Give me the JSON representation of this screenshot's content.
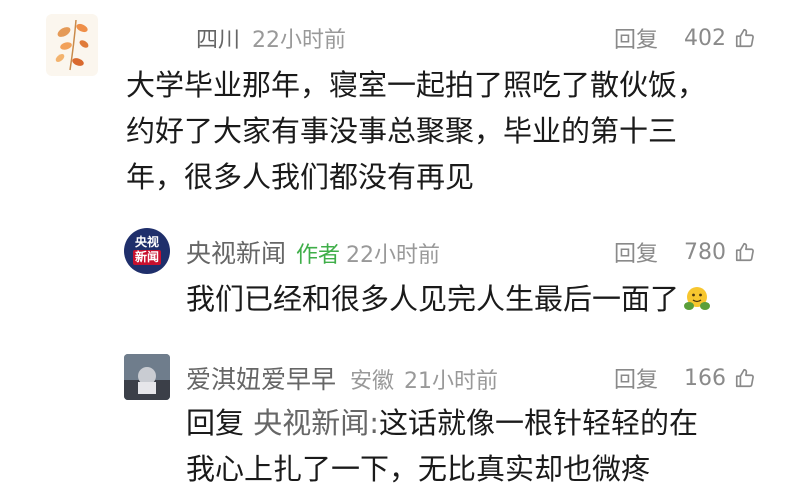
{
  "comments": [
    {
      "name": "四川",
      "time": "22小时前",
      "reply_label": "回复",
      "likes": "402",
      "lines": [
        "大学毕业那年，寝室一起拍了照吃了散伙饭，",
        "约好了大家有事没事总聚聚，毕业的第十三",
        "年，很多人我们都没有再见"
      ]
    },
    {
      "name": "央视新闻",
      "author_tag": "作者",
      "time": "22小时前",
      "reply_label": "回复",
      "likes": "780",
      "avatar_text_1": "央视",
      "avatar_text_2": "新闻",
      "text": "我们已经和很多人见完人生最后一面了",
      "emoji": "smiley-hug"
    },
    {
      "name": "爱淇妞爱早早",
      "location": "安徽",
      "time": "21小时前",
      "reply_label": "回复",
      "likes": "166",
      "reply_prefix": "回复",
      "reply_target": "央视新闻:",
      "line1_rest": "这话就像一根针轻轻的在",
      "line2": "我心上扎了一下，无比真实却也微疼"
    }
  ],
  "colors": {
    "author_tag": "#3fae49",
    "meta": "#999999",
    "text": "#1a1a1a",
    "cctv_badge": "#1f2f6b"
  }
}
